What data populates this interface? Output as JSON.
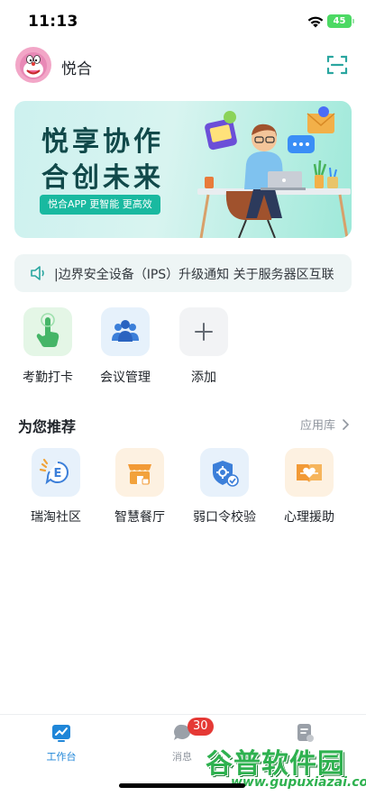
{
  "status_bar": {
    "time": "11:13",
    "battery": "45"
  },
  "header": {
    "name": "悦合",
    "avatar_icon": "avatar-doraemon",
    "scan_icon": "scan-icon"
  },
  "banner": {
    "line1": "悦享协作",
    "line2": "合创未来",
    "tag": "悦合APP 更智能 更高效"
  },
  "notice": {
    "text": "|边界安全设备（IPS）升级通知   关于服务器区互联"
  },
  "shortcuts": [
    {
      "label": "考勤打卡",
      "icon": "hand-tap-icon",
      "color": "#e4f6e6"
    },
    {
      "label": "会议管理",
      "icon": "people-icon",
      "color": "#e6f1fb"
    },
    {
      "label": "添加",
      "icon": "plus-icon",
      "color": "#f2f3f5"
    }
  ],
  "recommend": {
    "title": "为您推荐",
    "more": "应用库",
    "apps": [
      {
        "label": "瑞淘社区",
        "icon": "community-icon"
      },
      {
        "label": "智慧餐厅",
        "icon": "restaurant-icon"
      },
      {
        "label": "弱口令校验",
        "icon": "shield-check-icon"
      },
      {
        "label": "心理援助",
        "icon": "heart-book-icon"
      }
    ]
  },
  "tabbar": {
    "items": [
      {
        "label": "工作台",
        "icon": "workbench-icon"
      },
      {
        "label": "消息",
        "icon": "message-icon"
      },
      {
        "label": "",
        "icon": "contacts-icon"
      }
    ],
    "badge": "30"
  },
  "watermark": {
    "brand": "谷普软件园",
    "url": "www.gupuxiazai.com"
  }
}
